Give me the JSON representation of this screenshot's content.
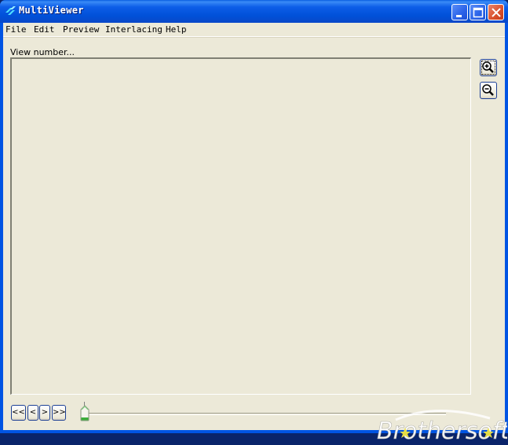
{
  "window": {
    "title": "MultiViewer",
    "icon": "app-icon",
    "controls": {
      "minimize": "minimize-icon",
      "maximize": "maximize-icon",
      "close": "close-icon"
    }
  },
  "menu": {
    "items": [
      {
        "label": "File"
      },
      {
        "label": "Edit"
      },
      {
        "label": "Preview"
      },
      {
        "label": "Interlacing"
      },
      {
        "label": "Help"
      }
    ]
  },
  "main": {
    "view_label": "View number...",
    "zoom_in": "zoom-in-icon",
    "zoom_out": "zoom-out-icon"
  },
  "navigation": {
    "first_label": "<<",
    "prev_label": "<",
    "next_label": ">",
    "last_label": ">>",
    "slider_position": 0
  },
  "watermark": {
    "text": "Brothersoft"
  },
  "colors": {
    "titlebar": "#0054e3",
    "face": "#ece9d8",
    "close": "#d9502c",
    "slider_thumb": "#3cae3c"
  }
}
